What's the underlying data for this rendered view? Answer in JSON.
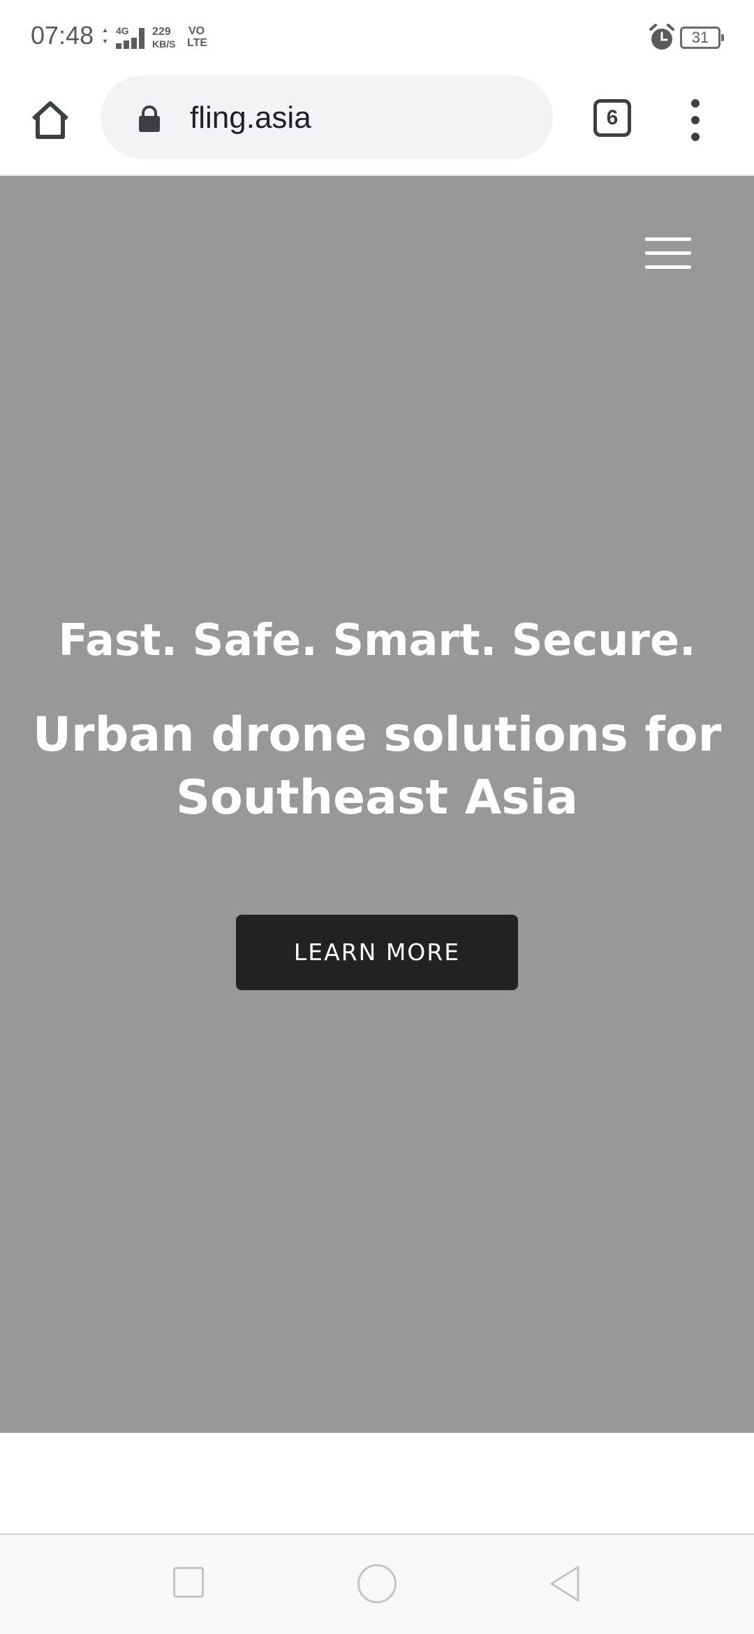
{
  "status_bar": {
    "time": "07:48",
    "network": "4G",
    "speed_value": "229",
    "speed_unit": "KB/S",
    "volte_top": "VO",
    "volte_bottom": "LTE",
    "battery": "31"
  },
  "browser": {
    "url": "fling.asia",
    "tab_count": "6"
  },
  "hero": {
    "tagline": "Fast. Safe. Smart. Secure.",
    "headline": "Urban drone solutions for Southeast Asia",
    "cta_label": "LEARN MORE",
    "background_color": "#989898"
  },
  "icons": {
    "home": "home-icon",
    "lock": "lock-icon",
    "menu": "more-vert-icon",
    "hamburger": "hamburger-menu-icon",
    "alarm": "alarm-icon"
  }
}
